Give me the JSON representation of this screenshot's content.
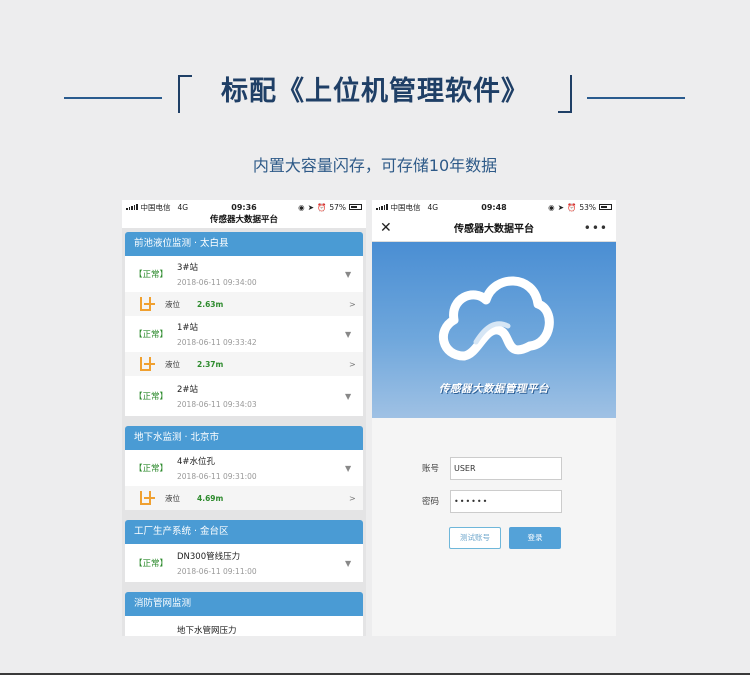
{
  "heading": {
    "title": "标配《上位机管理软件》",
    "subtitle": "内置大容量闪存，可存储10年数据"
  },
  "phone1": {
    "status": {
      "carrier": "中国电信",
      "network": "4G",
      "time": "09:36",
      "battery": "57%"
    },
    "app_title": "传感器大数据平台",
    "groups": [
      {
        "title": "前池液位监测 · 太白县",
        "stations": [
          {
            "status": "【正常】",
            "name": "3#站",
            "time": "2018-06-11 09:34:00",
            "level_label": "液位",
            "level_value": "2.63m"
          },
          {
            "status": "【正常】",
            "name": "1#站",
            "time": "2018-06-11 09:33:42",
            "level_label": "液位",
            "level_value": "2.37m"
          },
          {
            "status": "【正常】",
            "name": "2#站",
            "time": "2018-06-11 09:34:03"
          }
        ]
      },
      {
        "title": "地下水监测 · 北京市",
        "stations": [
          {
            "status": "【正常】",
            "name": "4#水位孔",
            "time": "2018-06-11 09:31:00",
            "level_label": "液位",
            "level_value": "4.69m"
          }
        ]
      },
      {
        "title": "工厂生产系统 · 金台区",
        "stations": [
          {
            "status": "【正常】",
            "name": "DN300管线压力",
            "time": "2018-06-11 09:11:00"
          }
        ]
      },
      {
        "title": "消防管网监测",
        "stations": [
          {
            "name": "地下水管网压力"
          }
        ]
      }
    ]
  },
  "phone2": {
    "status": {
      "carrier": "中国电信",
      "network": "4G",
      "time": "09:48",
      "battery": "53%"
    },
    "app_title": "传感器大数据平台",
    "banner_text": "传感器大数据管理平台",
    "form": {
      "account_label": "账号",
      "account_value": "USER",
      "password_label": "密码",
      "password_value": "••••••"
    },
    "test_button": "测试账号",
    "login_button": "登录"
  },
  "colors": {
    "title": "#1f3f66",
    "group_header": "#4a9bd4",
    "ok_green": "#2e8b2e",
    "tank_orange": "#f0a030"
  }
}
